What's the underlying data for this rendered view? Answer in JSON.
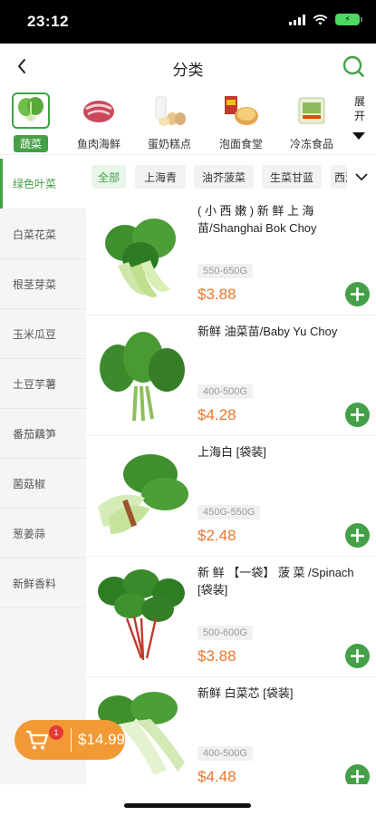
{
  "status_bar": {
    "time": "23:12",
    "battery_icon": "battery-charging-icon"
  },
  "navbar": {
    "title": "分类",
    "back_icon": "chevron-left-icon",
    "search_icon": "search-icon"
  },
  "top_categories": [
    {
      "label": "蔬菜",
      "icon": "vegetable-icon",
      "active": true
    },
    {
      "label": "鱼肉海鲜",
      "icon": "meat-icon",
      "active": false
    },
    {
      "label": "蛋奶糕点",
      "icon": "dairy-egg-icon",
      "active": false
    },
    {
      "label": "泡面食堂",
      "icon": "instant-noodle-icon",
      "active": false
    },
    {
      "label": "冷冻食品",
      "icon": "frozen-food-icon",
      "active": false
    }
  ],
  "expand": {
    "label": "展开"
  },
  "sidebar": {
    "items": [
      {
        "label": "绿色叶菜",
        "active": true
      },
      {
        "label": "白菜花菜",
        "active": false
      },
      {
        "label": "根茎芽菜",
        "active": false
      },
      {
        "label": "玉米瓜豆",
        "active": false
      },
      {
        "label": "土豆芋薯",
        "active": false
      },
      {
        "label": "番茄藕笋",
        "active": false
      },
      {
        "label": "菌菇椒",
        "active": false
      },
      {
        "label": "葱姜蒜",
        "active": false
      },
      {
        "label": "新鲜香料",
        "active": false
      }
    ]
  },
  "subtabs": [
    {
      "label": "全部",
      "active": true
    },
    {
      "label": "上海青",
      "active": false
    },
    {
      "label": "油芥菠菜",
      "active": false
    },
    {
      "label": "生菜甘蓝",
      "active": false
    },
    {
      "label": "西洋",
      "active": false
    }
  ],
  "products": [
    {
      "name": "( 小 西 嫩 ) 新 鲜 上 海 苗/Shanghai Bok Choy",
      "weight": "550-650G",
      "price": "$3.88",
      "image": "bok-choy-image"
    },
    {
      "name": "新鲜 油菜苗/Baby Yu Choy",
      "weight": "400-500G",
      "price": "$4.28",
      "image": "yu-choy-image"
    },
    {
      "name": "上海白 [袋装]",
      "weight": "450G-550G",
      "price": "$2.48",
      "image": "shanghai-bok-choy-bundle-image"
    },
    {
      "name": "新 鲜 【一袋】 菠 菜 /Spinach [袋装]",
      "weight": "500-600G",
      "price": "$3.88",
      "image": "spinach-image"
    },
    {
      "name": "新鲜 白菜芯 [袋装]",
      "weight": "400-500G",
      "price": "$4.48",
      "image": "baby-bok-choy-image"
    }
  ],
  "cart": {
    "badge": "1",
    "total": "$14.99"
  },
  "colors": {
    "accent": "#43a047",
    "price": "#e8762d",
    "cart": "#f19a35",
    "badge": "#e53935"
  }
}
